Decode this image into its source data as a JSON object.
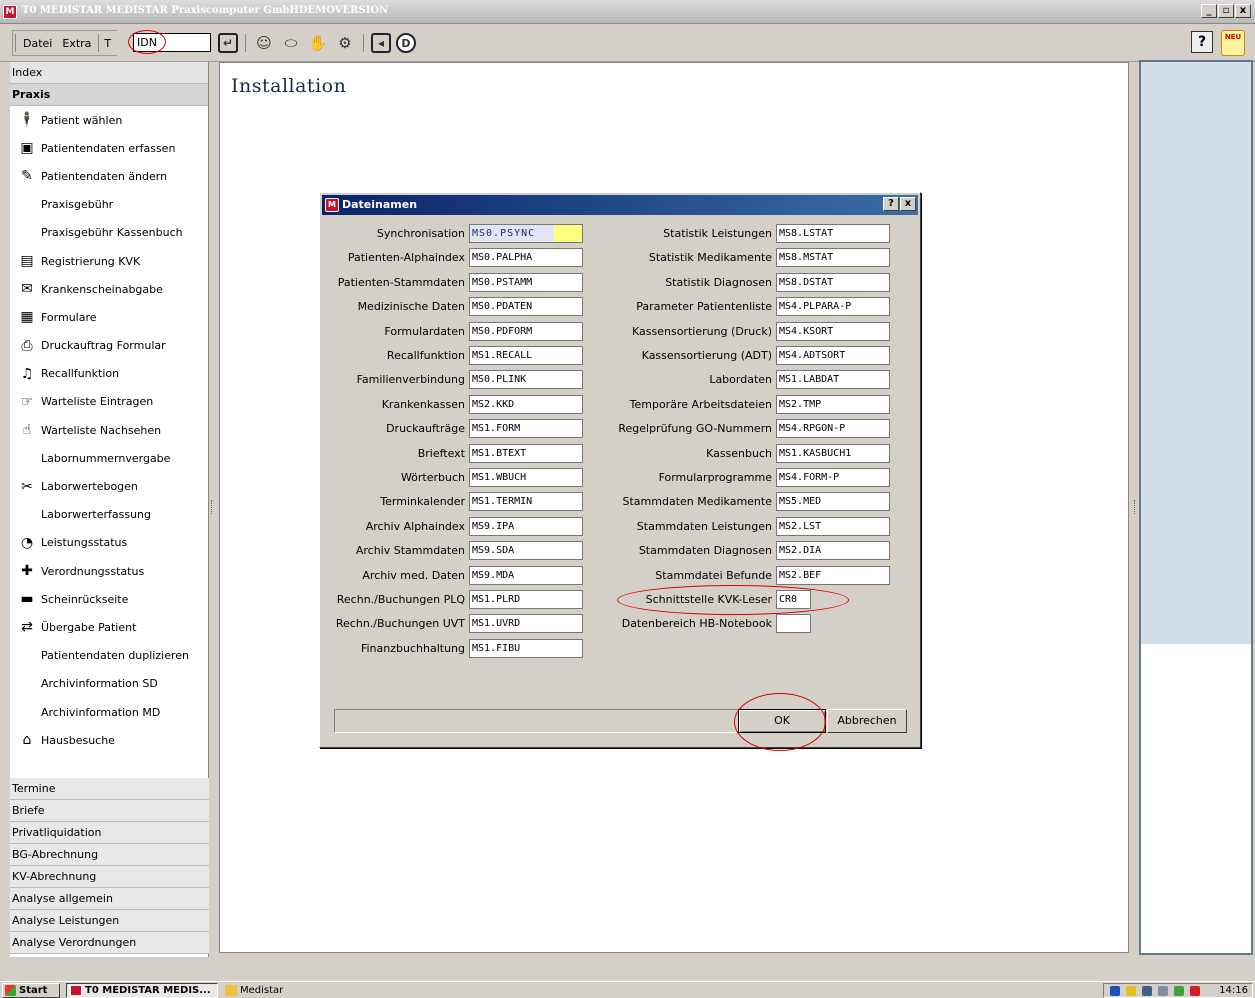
{
  "window": {
    "title": "T0 MEDISTAR  MEDISTAR Praxiscomputer GmbHDEMOVERSION",
    "minimize": "_",
    "maximize": "▫",
    "close": "x"
  },
  "toolbar": {
    "menu": [
      "Datei",
      "Extra"
    ],
    "t_label": "T",
    "idn_value": "IDN",
    "help_label": "?",
    "new_label": "NEU"
  },
  "sidebar": {
    "index_label": "Index",
    "praxis_label": "Praxis",
    "items": [
      {
        "label": "Patient wählen",
        "icon": "person-icon"
      },
      {
        "label": "Patientendaten erfassen",
        "icon": "person-form-icon"
      },
      {
        "label": "Patientendaten ändern",
        "icon": "person-edit-icon"
      },
      {
        "label": "Praxisgebühr",
        "icon": ""
      },
      {
        "label": "Praxisgebühr Kassenbuch",
        "icon": ""
      },
      {
        "label": "Registrierung KVK",
        "icon": "card-icon"
      },
      {
        "label": "Krankenscheinabgabe",
        "icon": "card-hand-icon"
      },
      {
        "label": "Formulare",
        "icon": "form-icon"
      },
      {
        "label": "Druckauftrag Formular",
        "icon": "printer-icon"
      },
      {
        "label": "Recallfunktion",
        "icon": "bell-icon"
      },
      {
        "label": "Warteliste Eintragen",
        "icon": "waitlist-add-icon"
      },
      {
        "label": "Warteliste Nachsehen",
        "icon": "waitlist-view-icon"
      },
      {
        "label": "Labornummernvergabe",
        "icon": ""
      },
      {
        "label": "Laborwertebogen",
        "icon": "lab-icon"
      },
      {
        "label": "Laborwerterfassung",
        "icon": ""
      },
      {
        "label": "Leistungsstatus",
        "icon": "status-icon"
      },
      {
        "label": "Verordnungsstatus",
        "icon": "prescription-icon"
      },
      {
        "label": "Scheinrückseite",
        "icon": "bed-icon"
      },
      {
        "label": "Übergabe Patient",
        "icon": "handover-icon"
      },
      {
        "label": "Patientendaten duplizieren",
        "icon": ""
      },
      {
        "label": "Archivinformation SD",
        "icon": ""
      },
      {
        "label": "Archivinformation MD",
        "icon": ""
      },
      {
        "label": "Hausbesuche",
        "icon": "housecall-icon"
      }
    ],
    "sections": [
      "Termine",
      "Briefe",
      "Privatliquidation",
      "BG-Abrechnung",
      "KV-Abrechnung",
      "Analyse allgemein",
      "Analyse Leistungen",
      "Analyse Verordnungen"
    ]
  },
  "main": {
    "title": "Installation"
  },
  "dialog": {
    "title": "Dateinamen",
    "help": "?",
    "close": "x",
    "left_fields": [
      {
        "label": "Synchronisation",
        "value": "MS0.PSYNC"
      },
      {
        "label": "Patienten-Alphaindex",
        "value": "MS0.PALPHA"
      },
      {
        "label": "Patienten-Stammdaten",
        "value": "MS0.PSTAMM"
      },
      {
        "label": "Medizinische Daten",
        "value": "MS0.PDATEN"
      },
      {
        "label": "Formulardaten",
        "value": "MS0.PDFORM"
      },
      {
        "label": "Recallfunktion",
        "value": "MS1.RECALL"
      },
      {
        "label": "Familienverbindung",
        "value": "MS0.PLINK"
      },
      {
        "label": "Krankenkassen",
        "value": "MS2.KKD"
      },
      {
        "label": "Druckaufträge",
        "value": "MS1.FORM"
      },
      {
        "label": "Brieftext",
        "value": "MS1.BTEXT"
      },
      {
        "label": "Wörterbuch",
        "value": "MS1.WBUCH"
      },
      {
        "label": "Terminkalender",
        "value": "MS1.TERMIN"
      },
      {
        "label": "Archiv Alphaindex",
        "value": "MS9.IPA"
      },
      {
        "label": "Archiv Stammdaten",
        "value": "MS9.SDA"
      },
      {
        "label": "Archiv med. Daten",
        "value": "MS9.MDA"
      },
      {
        "label": "Rechn./Buchungen PLQ",
        "value": "MS1.PLRD"
      },
      {
        "label": "Rechn./Buchungen UVT",
        "value": "MS1.UVRD"
      },
      {
        "label": "Finanzbuchhaltung",
        "value": "MS1.FIBU"
      }
    ],
    "right_fields": [
      {
        "label": "Statistik Leistungen",
        "value": "MS8.LSTAT"
      },
      {
        "label": "Statistik Medikamente",
        "value": "MS8.MSTAT"
      },
      {
        "label": "Statistik Diagnosen",
        "value": "MS8.DSTAT"
      },
      {
        "label": "Parameter Patientenliste",
        "value": "MS4.PLPARA-P"
      },
      {
        "label": "Kassensortierung (Druck)",
        "value": "MS4.KSORT"
      },
      {
        "label": "Kassensortierung (ADT)",
        "value": "MS4.ADTSORT"
      },
      {
        "label": "Labordaten",
        "value": "MS1.LABDAT"
      },
      {
        "label": "Temporäre Arbeitsdateien",
        "value": "MS2.TMP"
      },
      {
        "label": "Regelprüfung GO-Nummern",
        "value": "MS4.RPGON-P"
      },
      {
        "label": "Kassenbuch",
        "value": "MS1.KASBUCH1"
      },
      {
        "label": "Formularprogramme",
        "value": "MS4.FORM-P"
      },
      {
        "label": "Stammdaten Medikamente",
        "value": "MS5.MED"
      },
      {
        "label": "Stammdaten Leistungen",
        "value": "MS2.LST"
      },
      {
        "label": "Stammdaten Diagnosen",
        "value": "MS2.DIA"
      },
      {
        "label": "Stammdatei Befunde",
        "value": "MS2.BEF"
      },
      {
        "label": "Schnittstelle KVK-Leser",
        "value": "CR0"
      },
      {
        "label": "Datenbereich HB-Notebook",
        "value": ""
      }
    ],
    "ok_label": "OK",
    "cancel_label": "Abbrechen"
  },
  "taskbar": {
    "start_label": "Start",
    "tasks": [
      "T0 MEDISTAR MEDIS...",
      "Medistar"
    ],
    "clock": "14:16"
  },
  "colors": {
    "title_gradient_start": "#0a246a",
    "title_gradient_end": "#3a6ea5",
    "annotation_red": "#dd0000",
    "sync_highlight": "#ffff80",
    "right_panel": "#d3dde8"
  }
}
